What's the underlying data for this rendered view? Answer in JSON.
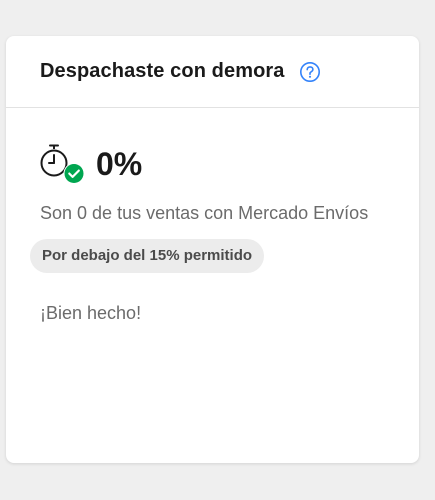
{
  "card": {
    "title": "Despachaste con demora",
    "help_icon": "question-circle-icon",
    "metric": {
      "icon": "stopwatch-check-icon",
      "value": "0%",
      "description": "Son 0 de tus ventas con Mercado Envíos"
    },
    "badge": "Por debajo del 15% permitido",
    "feedback": "¡Bien hecho!"
  },
  "colors": {
    "accent": "#3483fa",
    "success": "#00a650",
    "title": "#1a1a1a",
    "muted": "#6b6b6b",
    "badge_bg": "#ececec",
    "page_bg": "#efefef"
  }
}
